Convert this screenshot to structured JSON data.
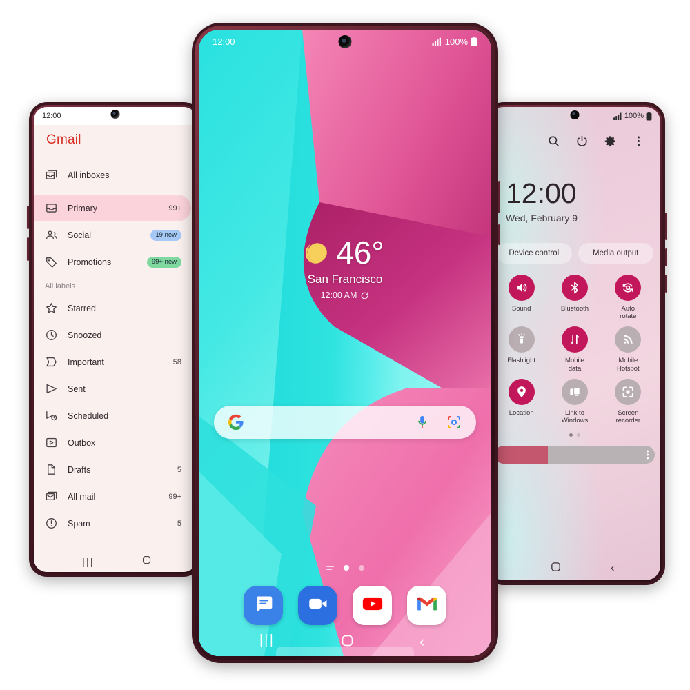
{
  "left_phone": {
    "name": "gmail-phone",
    "status": {
      "time": "12:00"
    },
    "app_title": "Gmail",
    "sections": [
      {
        "header": null,
        "items": [
          {
            "label": "All inboxes",
            "icon": "all-inboxes-icon",
            "count": "",
            "badge": "",
            "active": false
          }
        ]
      },
      {
        "header": null,
        "items": [
          {
            "label": "Primary",
            "icon": "inbox-icon",
            "count": "99+",
            "badge": "",
            "active": true
          },
          {
            "label": "Social",
            "icon": "people-icon",
            "count": "",
            "badge": "19 new",
            "badge_color": "blue",
            "active": false
          },
          {
            "label": "Promotions",
            "icon": "tag-icon",
            "count": "",
            "badge": "99+ new",
            "badge_color": "green",
            "active": false
          }
        ]
      },
      {
        "header": "All labels",
        "items": [
          {
            "label": "Starred",
            "icon": "star-icon",
            "count": "",
            "badge": "",
            "active": false
          },
          {
            "label": "Snoozed",
            "icon": "clock-icon",
            "count": "",
            "badge": "",
            "active": false
          },
          {
            "label": "Important",
            "icon": "important-icon",
            "count": "58",
            "badge": "",
            "active": false
          },
          {
            "label": "Sent",
            "icon": "send-icon",
            "count": "",
            "badge": "",
            "active": false
          },
          {
            "label": "Scheduled",
            "icon": "scheduled-icon",
            "count": "",
            "badge": "",
            "active": false
          },
          {
            "label": "Outbox",
            "icon": "outbox-icon",
            "count": "",
            "badge": "",
            "active": false
          },
          {
            "label": "Drafts",
            "icon": "draft-icon",
            "count": "5",
            "badge": "",
            "active": false
          },
          {
            "label": "All mail",
            "icon": "all-mail-icon",
            "count": "99+",
            "badge": "",
            "active": false
          },
          {
            "label": "Spam",
            "icon": "spam-icon",
            "count": "5",
            "badge": "",
            "active": false
          }
        ]
      }
    ],
    "nav": {
      "recents": "|||",
      "home": "home-icon"
    }
  },
  "center_phone": {
    "name": "home-screen-phone",
    "status": {
      "time": "12:00",
      "battery": "100%",
      "signal": "signal-icon"
    },
    "weather": {
      "icon": "crescent-moon-icon",
      "temperature": "46",
      "degree": "°",
      "city": "San Francisco",
      "updated": "12:00 AM",
      "refresh_icon": "refresh-icon"
    },
    "search": {
      "google_icon": "google-g-icon",
      "placeholder": "",
      "mic_icon": "microphone-icon",
      "lens_icon": "google-lens-icon"
    },
    "page_indicator": {
      "pages": 2,
      "active": 0
    },
    "dock": [
      {
        "label": "Messages",
        "icon": "messages-icon"
      },
      {
        "label": "Meet",
        "icon": "video-call-icon"
      },
      {
        "label": "YouTube",
        "icon": "youtube-icon"
      },
      {
        "label": "Gmail",
        "icon": "gmail-icon"
      }
    ],
    "nav": {
      "recents": "|||",
      "home": "home-icon",
      "back": "back-icon"
    }
  },
  "right_phone": {
    "name": "quick-settings-phone",
    "status": {
      "battery": "100%",
      "signal": "signal-icon"
    },
    "tools": [
      "search-icon",
      "power-icon",
      "gear-icon",
      "kebab-icon"
    ],
    "clock": "12:00",
    "date": "Wed, February 9",
    "pills": [
      {
        "label": "Device control"
      },
      {
        "label": "Media output"
      }
    ],
    "tiles": [
      {
        "label": "Sound",
        "icon": "volume-icon",
        "state": "on"
      },
      {
        "label": "Bluetooth",
        "icon": "bluetooth-icon",
        "state": "on"
      },
      {
        "label": "Auto\nrotate",
        "icon": "auto-rotate-icon",
        "state": "on"
      },
      {
        "label": "Flashlight",
        "icon": "flashlight-icon",
        "state": "off"
      },
      {
        "label": "Mobile\ndata",
        "icon": "mobile-data-icon",
        "state": "on"
      },
      {
        "label": "Mobile\nHotspot",
        "icon": "hotspot-icon",
        "state": "off"
      },
      {
        "label": "Location",
        "icon": "location-pin-icon",
        "state": "on"
      },
      {
        "label": "Link to\nWindows",
        "icon": "link-to-windows-icon",
        "state": "off"
      },
      {
        "label": "Screen\nrecorder",
        "icon": "screen-recorder-icon",
        "state": "off"
      }
    ],
    "brightness": {
      "percent": 33,
      "kebab_icon": "kebab-icon"
    },
    "nav": {
      "home": "home-icon",
      "back": "back-icon"
    }
  },
  "colors": {
    "accent_magenta": "#c2185b",
    "tile_off": "#b9aeb2",
    "gmail_red": "#d93025",
    "primary_highlight": "#fbd3da",
    "badge_blue": "#a6c8f5",
    "badge_green": "#7fd8a0",
    "frame": "#3d1620",
    "wallpaper_cyan": "#19e0de",
    "wallpaper_pink": "#f06aa8",
    "wallpaper_magenta": "#a81c63"
  }
}
